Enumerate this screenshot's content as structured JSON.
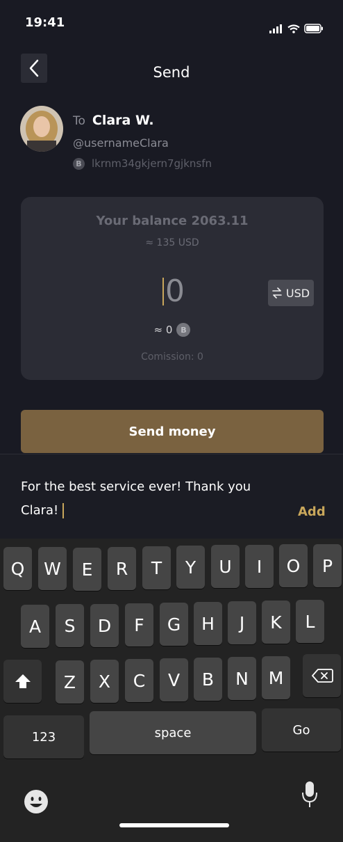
{
  "status": {
    "time": "19:41"
  },
  "header": {
    "title": "Send"
  },
  "recipient": {
    "to_label": "To",
    "name": "Clara W.",
    "username": "@usernameClara",
    "address": "lkrnm34gkjern7gjknsfn",
    "coin_symbol": "B"
  },
  "balance_card": {
    "balance_text": "Your balance 2063.11",
    "approx_text": "≈ 135 USD",
    "amount_value": "0",
    "currency_toggle_label": "USD",
    "converted_text": "≈ 0",
    "coin_symbol": "B",
    "commission_text": "Comission: 0"
  },
  "actions": {
    "send_label": "Send money"
  },
  "message": {
    "line1": "For the best service ever! Thank you",
    "line2": "Clara!",
    "add_label": "Add"
  },
  "keyboard": {
    "row1": [
      "Q",
      "W",
      "E",
      "R",
      "T",
      "Y",
      "U",
      "I",
      "O",
      "P"
    ],
    "row2": [
      "A",
      "S",
      "D",
      "F",
      "G",
      "H",
      "J",
      "K",
      "L"
    ],
    "row3": [
      "Z",
      "X",
      "C",
      "V",
      "B",
      "N",
      "M"
    ],
    "numbers_label": "123",
    "space_label": "space",
    "go_label": "Go",
    "icons": [
      "shift-icon",
      "backspace-icon",
      "emoji-icon",
      "microphone-icon"
    ]
  },
  "colors": {
    "background": "#191a23",
    "card": "#2b2c35",
    "accent_gold": "#c9a75b",
    "send_button": "#7a6240",
    "keyboard": "#232323"
  }
}
